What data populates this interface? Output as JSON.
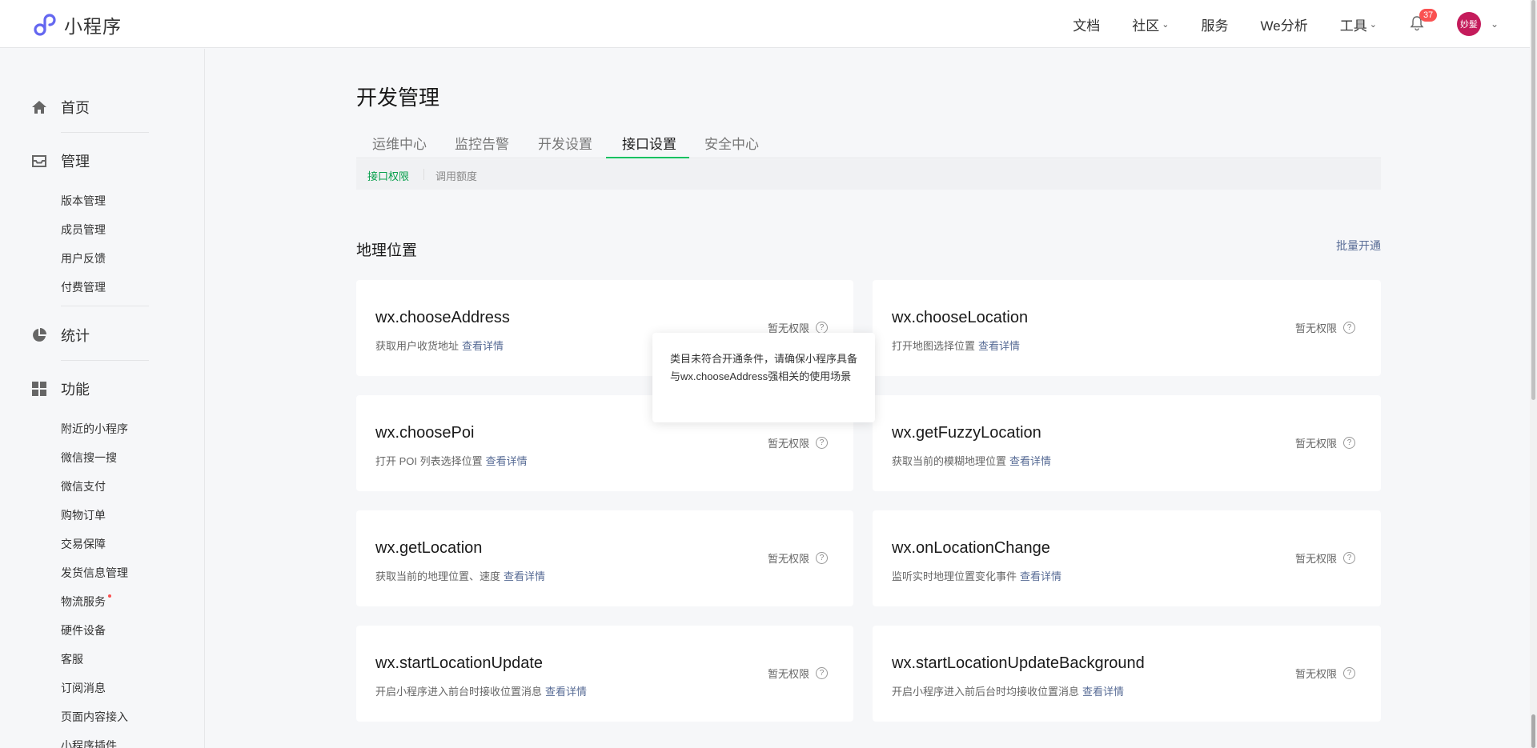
{
  "brand": {
    "name": "小程序"
  },
  "topnav": {
    "items": [
      {
        "label": "文档"
      },
      {
        "label": "社区",
        "chevron": true
      },
      {
        "label": "服务"
      },
      {
        "label": "We分析"
      },
      {
        "label": "工具",
        "chevron": true
      }
    ],
    "notifications": "37",
    "avatar_text": "妙髮"
  },
  "sidebar": {
    "home": "首页",
    "manage": "管理",
    "manage_items": [
      "版本管理",
      "成员管理",
      "用户反馈",
      "付费管理"
    ],
    "stats": "统计",
    "features": "功能",
    "feature_items": [
      "附近的小程序",
      "微信搜一搜",
      "微信支付",
      "购物订单",
      "交易保障",
      "发货信息管理",
      "物流服务",
      "硬件设备",
      "客服",
      "订阅消息",
      "页面内容接入",
      "小程序插件"
    ]
  },
  "page": {
    "title": "开发管理",
    "tabs": [
      "运维中心",
      "监控告警",
      "开发设置",
      "接口设置",
      "安全中心"
    ],
    "subtabs": [
      "接口权限",
      "调用额度"
    ],
    "section_title": "地理位置",
    "batch_open": "批量开通",
    "more_label": "查看详情",
    "no_permission": "暂无权限",
    "tooltip": "类目未符合开通条件，请确保小程序具备与wx.chooseAddress强相关的使用场景"
  },
  "apis": [
    {
      "name": "wx.chooseAddress",
      "desc": "获取用户收货地址"
    },
    {
      "name": "wx.chooseLocation",
      "desc": "打开地图选择位置"
    },
    {
      "name": "wx.choosePoi",
      "desc": "打开 POI 列表选择位置"
    },
    {
      "name": "wx.getFuzzyLocation",
      "desc": "获取当前的模糊地理位置"
    },
    {
      "name": "wx.getLocation",
      "desc": "获取当前的地理位置、速度"
    },
    {
      "name": "wx.onLocationChange",
      "desc": "监听实时地理位置变化事件"
    },
    {
      "name": "wx.startLocationUpdate",
      "desc": "开启小程序进入前台时接收位置消息"
    },
    {
      "name": "wx.startLocationUpdateBackground",
      "desc": "开启小程序进入前后台时均接收位置消息"
    }
  ],
  "colors": {
    "accent": "#07c160",
    "link": "#576b95",
    "badge": "#fa5151"
  }
}
